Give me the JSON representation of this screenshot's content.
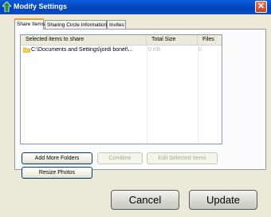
{
  "window": {
    "title": "Modify Settings",
    "close_symbol": "✕"
  },
  "tabs": [
    {
      "label": "Share Items",
      "active": true
    },
    {
      "label": "Sharing Circle Information",
      "active": false
    },
    {
      "label": "Invites",
      "active": false
    }
  ],
  "table": {
    "columns": [
      "Selected items to share",
      "Total Size",
      "Files"
    ],
    "rows": [
      {
        "path": "C:\\Documents and Settings\\jordi bonet\\...",
        "size": "0 KB",
        "files": "0"
      }
    ]
  },
  "buttons": {
    "add_more_folders": "Add More Folders",
    "combine": "Combine",
    "edit_selected_items": "Edit Selected Items",
    "resize_photos": "Resize Photos",
    "cancel": "Cancel",
    "update": "Update"
  },
  "colors": {
    "title_bar": "#0a5bd8",
    "frame": "#ece9d8",
    "tab_highlight": "#f0a020",
    "disabled_text": "#aca899"
  },
  "icons": [
    "app-icon",
    "close-icon",
    "folder-icon"
  ]
}
